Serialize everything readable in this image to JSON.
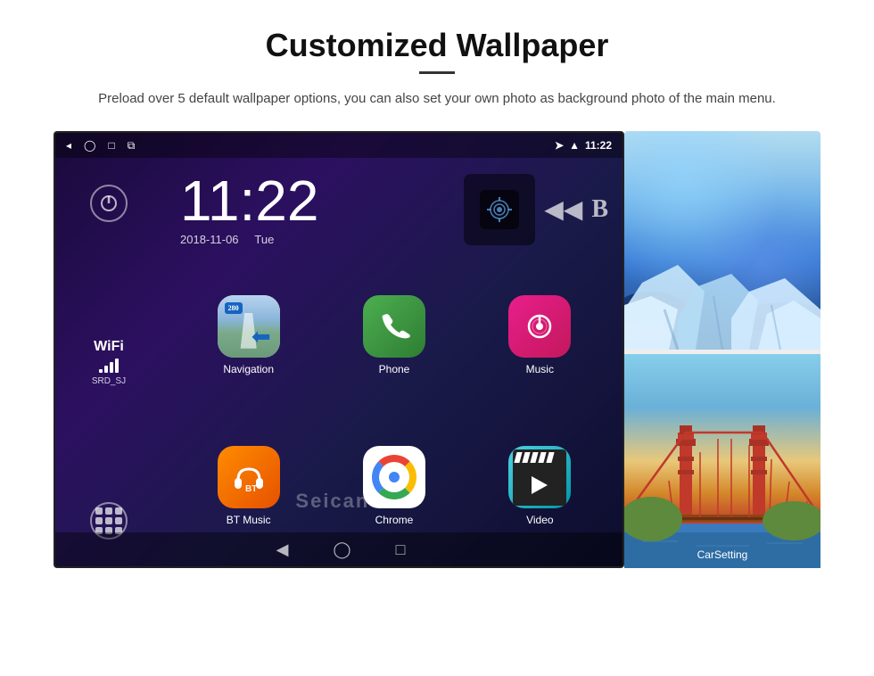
{
  "page": {
    "title": "Customized Wallpaper",
    "divider": true,
    "subtitle": "Preload over 5 default wallpaper options, you can also set your own photo as background photo of the main menu."
  },
  "screen": {
    "time": "11:22",
    "date": "2018-11-06",
    "day": "Tue",
    "wifi": {
      "label": "WiFi",
      "ssid": "SRD_SJ"
    },
    "status_bar": {
      "time": "11:22",
      "icons": [
        "back-arrow",
        "home-circle",
        "square",
        "image"
      ]
    }
  },
  "apps": [
    {
      "id": "navigation",
      "label": "Navigation",
      "badge": "280"
    },
    {
      "id": "phone",
      "label": "Phone"
    },
    {
      "id": "music",
      "label": "Music"
    },
    {
      "id": "bt_music",
      "label": "BT Music"
    },
    {
      "id": "chrome",
      "label": "Chrome"
    },
    {
      "id": "video",
      "label": "Video"
    }
  ],
  "right_panels": {
    "top_label": "glacier wallpaper",
    "bottom_label": "CarSetting",
    "bridge_label": "Golden Gate Bridge wallpaper"
  },
  "watermark": "Seicane",
  "colors": {
    "background": "#1a0a3c",
    "accent": "#4285F4",
    "nav_blue": "#1565c0",
    "phone_green": "#4CAF50",
    "music_pink": "#e91e8c",
    "bt_orange": "#ff8c00",
    "video_teal": "#4dd0e1"
  }
}
